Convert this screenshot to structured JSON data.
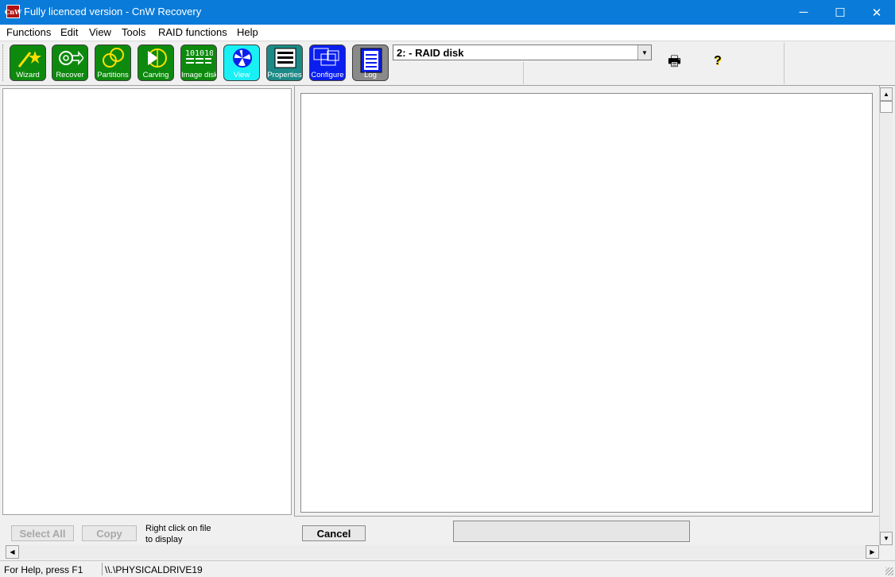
{
  "window": {
    "title": "Fully licenced version - CnW Recovery",
    "icon_text": "CnW",
    "minimize": "─",
    "maximize": "☐",
    "close": "✕"
  },
  "menu": [
    "Functions",
    "Edit",
    "View",
    "Tools",
    "RAID functions",
    "Help"
  ],
  "toolbar": {
    "buttons": [
      {
        "label": "Wizard",
        "icon": "wizard-icon",
        "color": "#0d8a0d"
      },
      {
        "label": "Recover",
        "icon": "recover-icon",
        "color": "#0d8a0d"
      },
      {
        "label": "Partitions",
        "icon": "partitions-icon",
        "color": "#0d8a0d"
      },
      {
        "label": "Carving",
        "icon": "carving-icon",
        "color": "#0d8a0d"
      },
      {
        "label": "Image disk",
        "icon": "image-disk-icon",
        "color": "#0d8a0d"
      },
      {
        "label": "View",
        "icon": "view-icon",
        "color": "#19f0f5"
      },
      {
        "label": "Properties",
        "icon": "properties-icon",
        "color": "#1c8a86"
      },
      {
        "label": "Configure",
        "icon": "configure-icon",
        "color": "#0a1ef0"
      },
      {
        "label": "Log",
        "icon": "log-icon",
        "color": "#8a8a8a"
      }
    ],
    "disk_select": "2: - RAID disk",
    "print_icon": "printer-icon",
    "help_icon": "help-icon",
    "print_glyph": "🖶",
    "help_glyph": "?"
  },
  "bottom": {
    "select_all": "Select All",
    "copy": "Copy",
    "hint_line1": "Right click on file",
    "hint_line2": "to display",
    "cancel": "Cancel"
  },
  "status": {
    "help": "For Help, press F1",
    "drive": "\\\\.\\PHYSICALDRIVE19"
  }
}
